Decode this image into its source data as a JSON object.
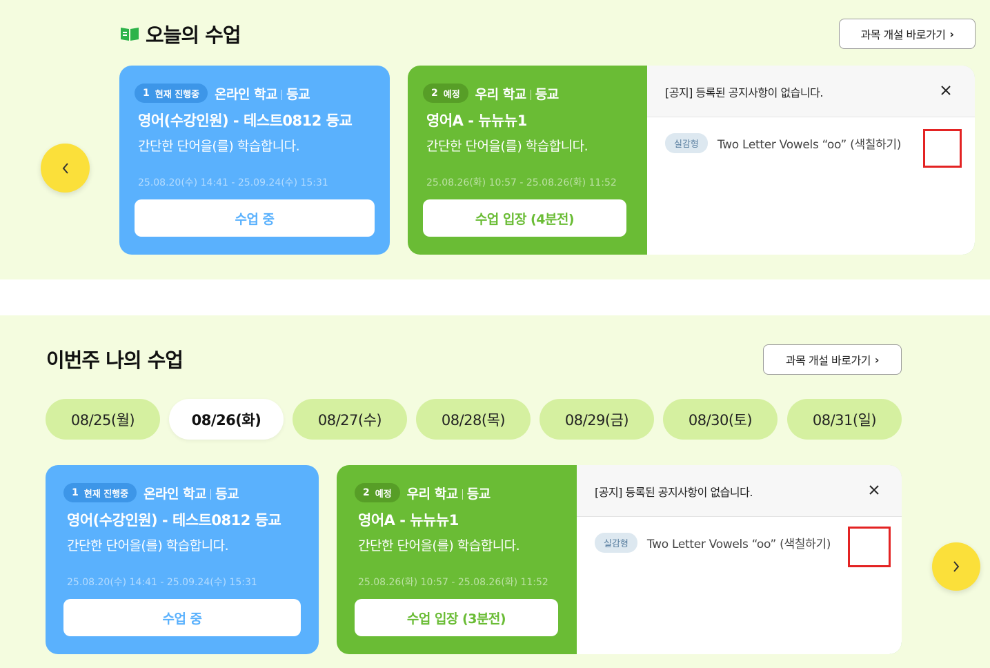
{
  "today": {
    "title": "오늘의 수업",
    "shortcut_label": "과목 개설 바로가기",
    "cards": [
      {
        "num": "1",
        "status": "현재 진행중",
        "school": "온라인 학교",
        "kind": "등교",
        "title": "영어(수강인원) - 테스트0812 등교",
        "desc": "간단한 단어을(를) 학습합니다.",
        "time": "25.08.20(수) 14:41 - 25.09.24(수) 15:31",
        "button": "수업 중"
      },
      {
        "num": "2",
        "status": "예정",
        "school": "우리 학교",
        "kind": "등교",
        "title": "영어A - 뉴뉴뉴1",
        "desc": "간단한 단어을(를) 학습합니다.",
        "time": "25.08.26(화) 10:57 - 25.08.26(화) 11:52",
        "button": "수업 입장 (4분전)",
        "notice": {
          "text": "[공지] 등록된 공지사항이 없습니다.",
          "tag": "실감형",
          "item": "Two Letter Vowels “oo” (색칠하기)"
        }
      }
    ]
  },
  "week": {
    "title": "이번주 나의 수업",
    "shortcut_label": "과목 개설 바로가기",
    "days": [
      "08/25(월)",
      "08/26(화)",
      "08/27(수)",
      "08/28(목)",
      "08/29(금)",
      "08/30(토)",
      "08/31(일)"
    ],
    "active_day": "08/26(화)",
    "cards": [
      {
        "num": "1",
        "status": "현재 진행중",
        "school": "온라인 학교",
        "kind": "등교",
        "title": "영어(수강인원) - 테스트0812 등교",
        "desc": "간단한 단어을(를) 학습합니다.",
        "time": "25.08.20(수) 14:41 - 25.09.24(수) 15:31",
        "button": "수업 중"
      },
      {
        "num": "2",
        "status": "예정",
        "school": "우리 학교",
        "kind": "등교",
        "title": "영어A - 뉴뉴뉴1",
        "desc": "간단한 단어을(를) 학습합니다.",
        "time": "25.08.26(화) 10:57 - 25.08.26(화) 11:52",
        "button": "수업 입장 (3분전)",
        "notice": {
          "text": "[공지] 등록된 공지사항이 없습니다.",
          "tag": "실감형",
          "item": "Two Letter Vowels “oo” (색칠하기)"
        }
      }
    ]
  },
  "colors": {
    "blue_card": "#5ab1fd",
    "green_card": "#6abc35",
    "background": "#f4fcdf",
    "nav_button": "#fbe03a",
    "highlight_box": "#e32323"
  },
  "icons": {
    "section_icon": "book-icon",
    "prev": "chevron-left-icon",
    "next": "chevron-right-icon",
    "close": "close-icon"
  }
}
